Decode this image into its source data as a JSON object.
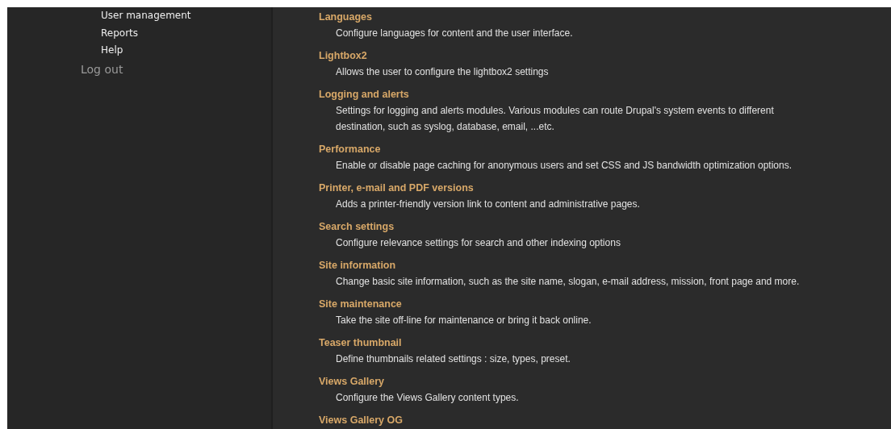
{
  "sidebar": {
    "menu_items": [
      {
        "label": "User management"
      },
      {
        "label": "Reports"
      },
      {
        "label": "Help"
      }
    ],
    "logout": "Log out"
  },
  "settings": [
    {
      "title": "Languages",
      "description": "Configure languages for content and the user interface."
    },
    {
      "title": "Lightbox2",
      "description": "Allows the user to configure the lightbox2 settings"
    },
    {
      "title": "Logging and alerts",
      "description": "Settings for logging and alerts modules. Various modules can route Drupal's system events to different destination, such as syslog, database, email, ...etc."
    },
    {
      "title": "Performance",
      "description": "Enable or disable page caching for anonymous users and set CSS and JS bandwidth optimization options."
    },
    {
      "title": "Printer, e-mail and PDF versions",
      "description": "Adds a printer-friendly version link to content and administrative pages."
    },
    {
      "title": "Search settings",
      "description": "Configure relevance settings for search and other indexing options"
    },
    {
      "title": "Site information",
      "description": "Change basic site information, such as the site name, slogan, e-mail address, mission, front page and more."
    },
    {
      "title": "Site maintenance",
      "description": "Take the site off-line for maintenance or bring it back online."
    },
    {
      "title": "Teaser thumbnail",
      "description": "Define thumbnails related settings : size, types, preset."
    },
    {
      "title": "Views Gallery",
      "description": "Configure the Views Gallery content types."
    },
    {
      "title": "Views Gallery OG"
    }
  ]
}
